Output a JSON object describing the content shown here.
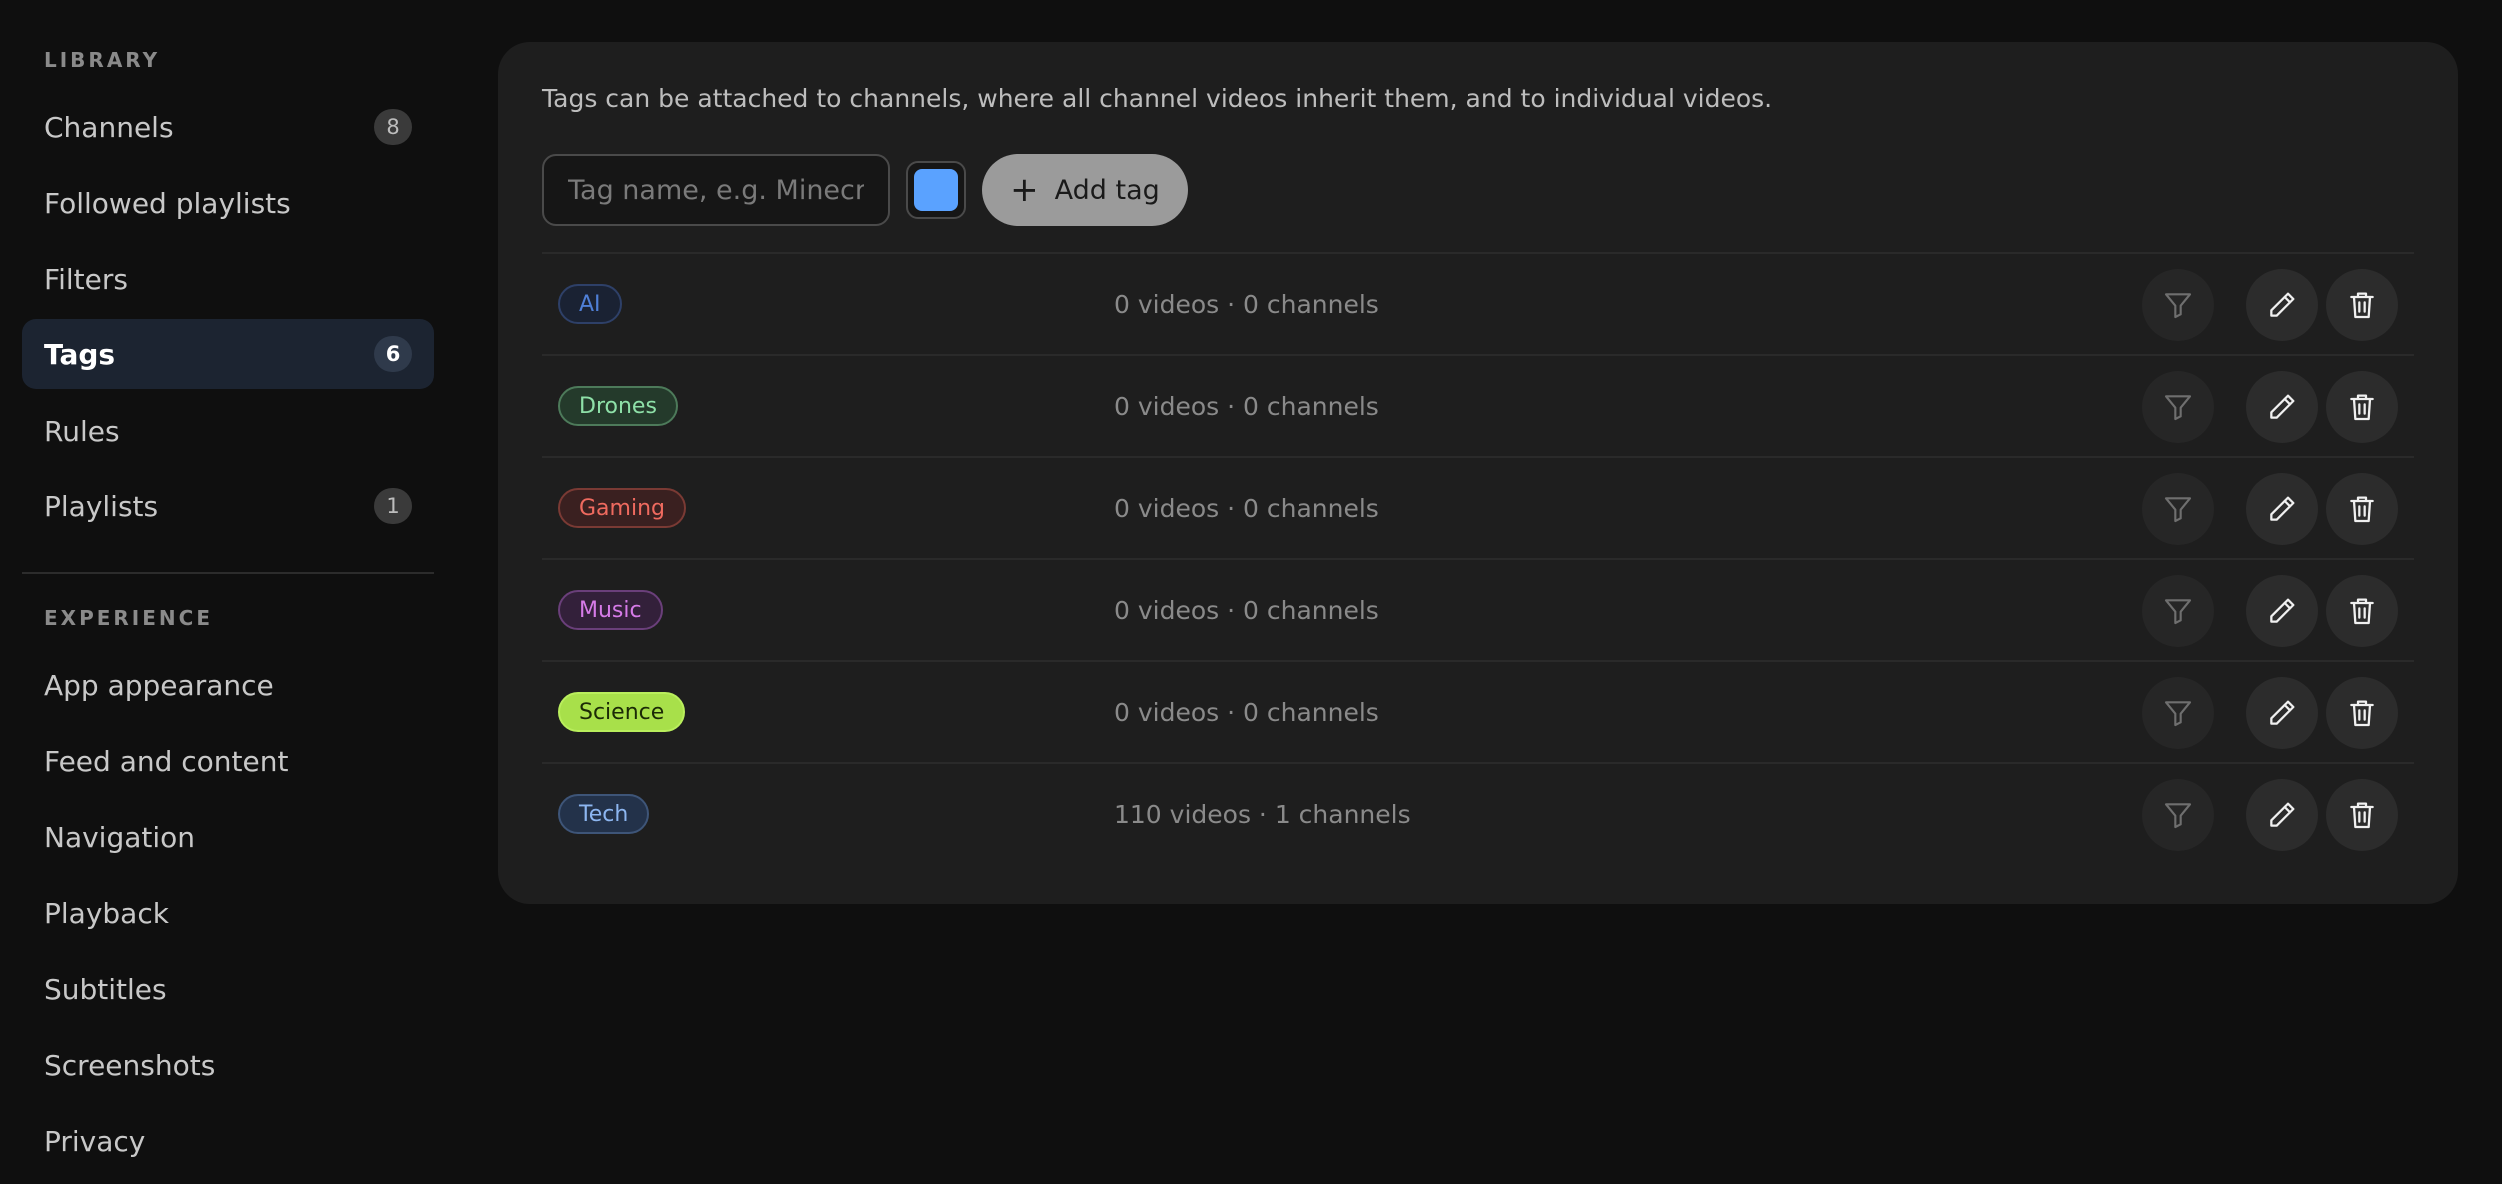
{
  "sidebar": {
    "library_label": "LIBRARY",
    "library_items": [
      {
        "label": "Channels",
        "badge": "8"
      },
      {
        "label": "Followed playlists",
        "badge": ""
      },
      {
        "label": "Filters",
        "badge": ""
      },
      {
        "label": "Tags",
        "badge": "6",
        "active": true
      },
      {
        "label": "Rules",
        "badge": ""
      },
      {
        "label": "Playlists",
        "badge": "1"
      }
    ],
    "experience_label": "EXPERIENCE",
    "experience_items": [
      {
        "label": "App appearance"
      },
      {
        "label": "Feed and content"
      },
      {
        "label": "Navigation"
      },
      {
        "label": "Playback"
      },
      {
        "label": "Subtitles"
      },
      {
        "label": "Screenshots"
      },
      {
        "label": "Privacy"
      }
    ]
  },
  "main": {
    "intro": "Tags can be attached to channels, where all channel videos inherit them, and to individual videos.",
    "input_placeholder": "Tag name, e.g. Minecraft",
    "input_value": "",
    "selected_color": "#5aa2ff",
    "add_label": "Add tag",
    "tags": [
      {
        "name": "AI",
        "stats": "0 videos · 0 channels",
        "text": "#4f7fd6",
        "bg": "#1a2233",
        "border": "#2e4068"
      },
      {
        "name": "Drones",
        "stats": "0 videos · 0 channels",
        "text": "#8ee0a8",
        "bg": "#243a2b",
        "border": "#4d7a5a"
      },
      {
        "name": "Gaming",
        "stats": "0 videos · 0 channels",
        "text": "#ef6a5f",
        "bg": "#3a2020",
        "border": "#7a3a34"
      },
      {
        "name": "Music",
        "stats": "0 videos · 0 channels",
        "text": "#d67be8",
        "bg": "#33203a",
        "border": "#6a3f7a"
      },
      {
        "name": "Science",
        "stats": "0 videos · 0 channels",
        "text": "#1b2a06",
        "bg": "#a8e04a",
        "border": "#b9ee5c"
      },
      {
        "name": "Tech",
        "stats": "110 videos · 1 channels",
        "text": "#8db6f0",
        "bg": "#23324a",
        "border": "#3e5578"
      }
    ]
  }
}
